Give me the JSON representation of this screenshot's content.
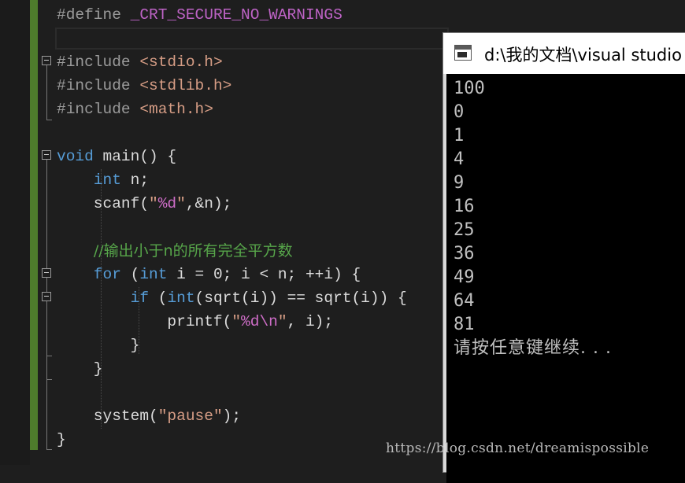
{
  "code_lines": [
    {
      "parts": [
        {
          "t": "#define ",
          "c": "pp"
        },
        {
          "t": "_CRT_SECURE_NO_WARNINGS",
          "c": "macro"
        }
      ]
    },
    {
      "parts": [
        {
          "t": "",
          "c": "plain"
        }
      ]
    },
    {
      "parts": [
        {
          "t": "#include ",
          "c": "pp"
        },
        {
          "t": "<stdio.h>",
          "c": "inc"
        }
      ]
    },
    {
      "parts": [
        {
          "t": "#include ",
          "c": "pp"
        },
        {
          "t": "<stdlib.h>",
          "c": "inc"
        }
      ]
    },
    {
      "parts": [
        {
          "t": "#include ",
          "c": "pp"
        },
        {
          "t": "<math.h>",
          "c": "inc"
        }
      ]
    },
    {
      "parts": [
        {
          "t": "",
          "c": "plain"
        }
      ]
    },
    {
      "parts": [
        {
          "t": "void",
          "c": "kw"
        },
        {
          "t": " main() {",
          "c": "plain"
        }
      ]
    },
    {
      "parts": [
        {
          "t": "    ",
          "c": "plain"
        },
        {
          "t": "int",
          "c": "kw"
        },
        {
          "t": " n;",
          "c": "plain"
        }
      ]
    },
    {
      "parts": [
        {
          "t": "    scanf(",
          "c": "plain"
        },
        {
          "t": "\"",
          "c": "str"
        },
        {
          "t": "%d",
          "c": "fmt"
        },
        {
          "t": "\"",
          "c": "str"
        },
        {
          "t": ",&n);",
          "c": "plain"
        }
      ]
    },
    {
      "parts": [
        {
          "t": "",
          "c": "plain"
        }
      ]
    },
    {
      "parts": [
        {
          "t": "    ",
          "c": "plain"
        },
        {
          "t": "//输出小于n的所有完全平方数",
          "c": "cmt"
        }
      ]
    },
    {
      "parts": [
        {
          "t": "    ",
          "c": "plain"
        },
        {
          "t": "for",
          "c": "kw"
        },
        {
          "t": " (",
          "c": "plain"
        },
        {
          "t": "int",
          "c": "kw"
        },
        {
          "t": " i = 0; i < n; ++i) {",
          "c": "plain"
        }
      ]
    },
    {
      "parts": [
        {
          "t": "        ",
          "c": "plain"
        },
        {
          "t": "if",
          "c": "kw"
        },
        {
          "t": " (",
          "c": "plain"
        },
        {
          "t": "int",
          "c": "kw"
        },
        {
          "t": "(sqrt(i)) == sqrt(i)) {",
          "c": "plain"
        }
      ]
    },
    {
      "parts": [
        {
          "t": "            printf(",
          "c": "plain"
        },
        {
          "t": "\"",
          "c": "str"
        },
        {
          "t": "%d\\n",
          "c": "fmt"
        },
        {
          "t": "\"",
          "c": "str"
        },
        {
          "t": ", i);",
          "c": "plain"
        }
      ]
    },
    {
      "parts": [
        {
          "t": "        }",
          "c": "plain"
        }
      ]
    },
    {
      "parts": [
        {
          "t": "    }",
          "c": "plain"
        }
      ]
    },
    {
      "parts": [
        {
          "t": "",
          "c": "plain"
        }
      ]
    },
    {
      "parts": [
        {
          "t": "    system(",
          "c": "plain"
        },
        {
          "t": "\"pause\"",
          "c": "str"
        },
        {
          "t": ");",
          "c": "plain"
        }
      ]
    },
    {
      "parts": [
        {
          "t": "}",
          "c": "plain"
        }
      ]
    }
  ],
  "console": {
    "title": "d:\\我的文档\\visual studio",
    "icon": "console-window-icon",
    "output": [
      "100",
      "0",
      "1",
      "4",
      "9",
      "16",
      "25",
      "36",
      "49",
      "64",
      "81",
      "请按任意键继续. . ."
    ]
  },
  "watermark": "https://blog.csdn.net/dreamispossible",
  "colors": {
    "editor_bg": "#1e1e1e",
    "change_bar": "#4e7c2c",
    "keyword": "#569cd6",
    "string": "#d69d85",
    "comment": "#57a64a",
    "macro": "#bd63c5",
    "console_bg": "#000000",
    "console_text": "#c0c0c0"
  }
}
